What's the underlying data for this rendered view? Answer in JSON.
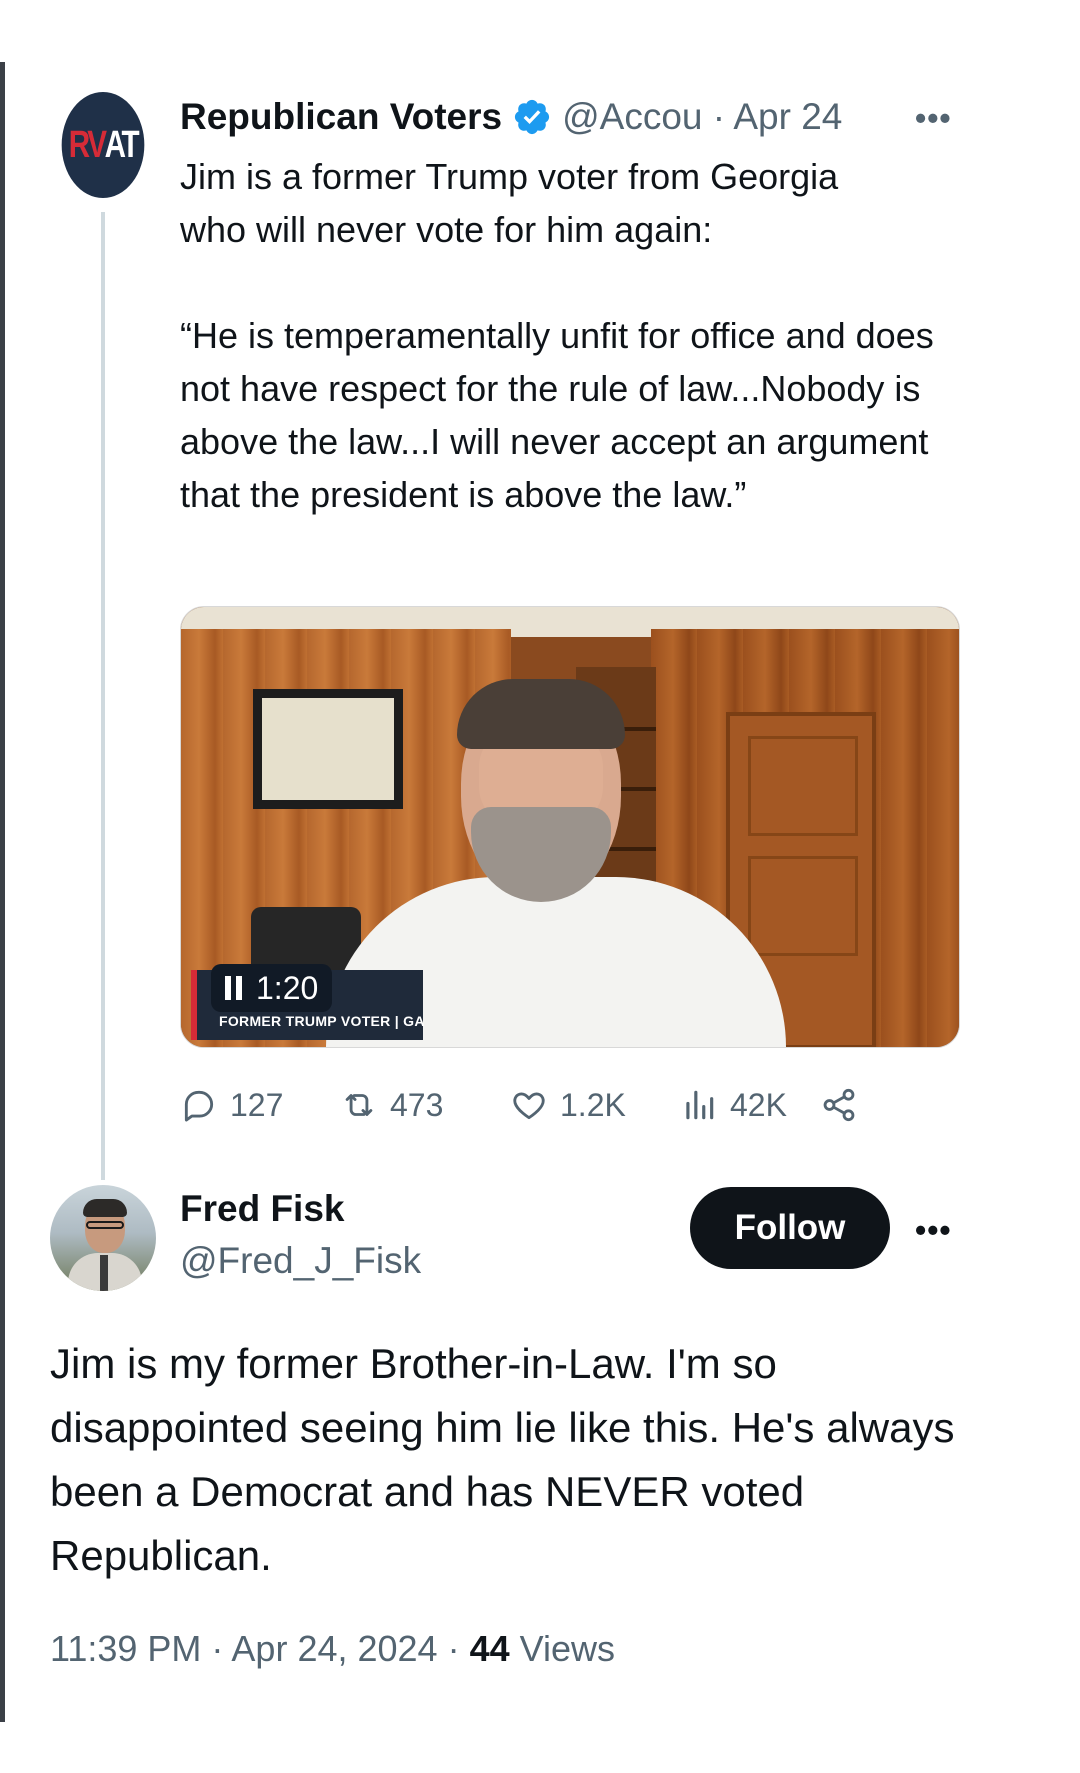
{
  "parent_tweet": {
    "avatar_text_red": "RV",
    "avatar_text_white": "AT",
    "display_name": "Republican Voters",
    "handle_date": "@Accou · Apr 24",
    "more": "•••",
    "text_line1": "Jim is a former Trump voter from Georgia",
    "text_line2": "who will never vote for him again:",
    "quote": "“He is temperamentally unfit for office and does not have respect for the rule of law...Nobody is above the law...I will never accept an argument that the president is above the law.”",
    "video": {
      "timestamp": "1:20",
      "caption": "FORMER TRUMP VOTER | GA",
      "state": "playing"
    },
    "actions": {
      "replies": "127",
      "reposts": "473",
      "likes": "1.2K",
      "views": "42K"
    },
    "colors": {
      "avatar_bg": "#1f3048",
      "avatar_red": "#d62b37",
      "verified": "#1d9bf0",
      "secondary_text": "#536471"
    }
  },
  "reply_tweet": {
    "display_name": "Fred Fisk",
    "handle": "@Fred_J_Fisk",
    "follow_label": "Follow",
    "more": "•••",
    "text": "Jim is my former Brother-in-Law. I'm so disappointed seeing him lie like this. He's always been a Democrat and has NEVER voted Republican.",
    "time_date": "11:39 PM · Apr 24, 2024 · ",
    "views_count": "44",
    "views_label": " Views"
  },
  "icons": [
    "verified-badge-icon",
    "more-icon",
    "pause-icon",
    "reply-icon",
    "repost-icon",
    "like-icon",
    "views-icon",
    "share-icon"
  ]
}
